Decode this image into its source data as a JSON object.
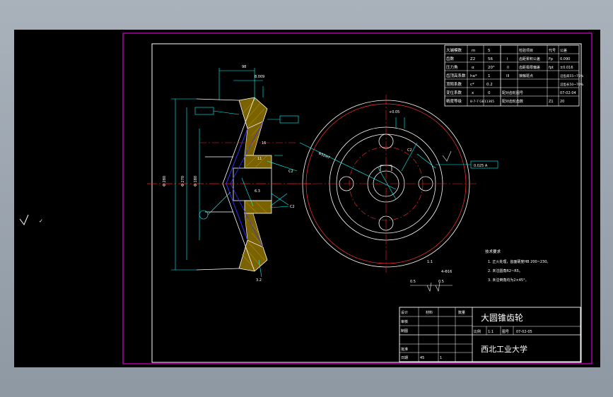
{
  "colors": {
    "viewport_bg": "#000000",
    "frame_magenta": "#ff00ff",
    "geometry_white": "#ffffff",
    "center_red": "#ff2020",
    "dim_cyan": "#00ffff",
    "blue": "#3030ff",
    "hatch_yellow": "#c8a400",
    "red_circle": "#ff3030"
  },
  "title_block": {
    "part_name": "大圆锥齿轮",
    "school": "西北工业大学",
    "scale_label": "比例",
    "scale": "1:1",
    "drawing_no_label": "图号",
    "drawing_no": "07-02-05",
    "designer_label": "设计",
    "reviewer_label": "审核",
    "drafter_label": "制图",
    "approver_label": "批准",
    "date_label": "日期",
    "material_label": "材料",
    "material": "45",
    "quantity_label": "数量",
    "quantity": "1"
  },
  "param_table": {
    "rows": [
      {
        "name": "大端模数",
        "sym": "m",
        "val": "5"
      },
      {
        "name": "齿数",
        "sym": "Z2",
        "val": "56"
      },
      {
        "name": "压力角",
        "sym": "α",
        "val": "20°"
      },
      {
        "name": "齿顶高系数",
        "sym": "ha*",
        "val": "1"
      },
      {
        "name": "顶隙系数",
        "sym": "c*",
        "val": "0.2"
      },
      {
        "name": "变位系数",
        "sym": "x",
        "val": "0"
      },
      {
        "name": "精度等级",
        "sym": "",
        "val": "8-7-7 GB11365"
      }
    ],
    "tolerance_rows": [
      {
        "group": "",
        "name": "检验项目",
        "sym": "代号",
        "val": "公差"
      },
      {
        "group": "I",
        "name": "齿距累积公差",
        "sym": "Fp",
        "val": "0.090"
      },
      {
        "group": "II",
        "name": "齿距极限偏差",
        "sym": "fpt",
        "val": "±0.016"
      },
      {
        "group": "III",
        "name": "接触斑点",
        "sym": "",
        "val": "沿齿高55~75%"
      },
      {
        "group": "",
        "name": "",
        "sym": "",
        "val": "沿齿长50~70%"
      },
      {
        "group": "",
        "name": "配对齿轮图号",
        "sym": "",
        "val": "07-02-04"
      },
      {
        "group": "",
        "name": "配对齿轮齿数",
        "sym": "Z1",
        "val": "20"
      }
    ]
  },
  "tech_requirements": {
    "heading": "技术要求",
    "items": [
      "1. 正火处理，齿面硬度HB 200~230。",
      "2. 未注圆角R2~R5。",
      "3. 未注倒角均为2×45°。"
    ]
  },
  "annotations": {
    "left_symbol": "✓",
    "scale_note": "1:1",
    "detail_scale": "1:1"
  }
}
